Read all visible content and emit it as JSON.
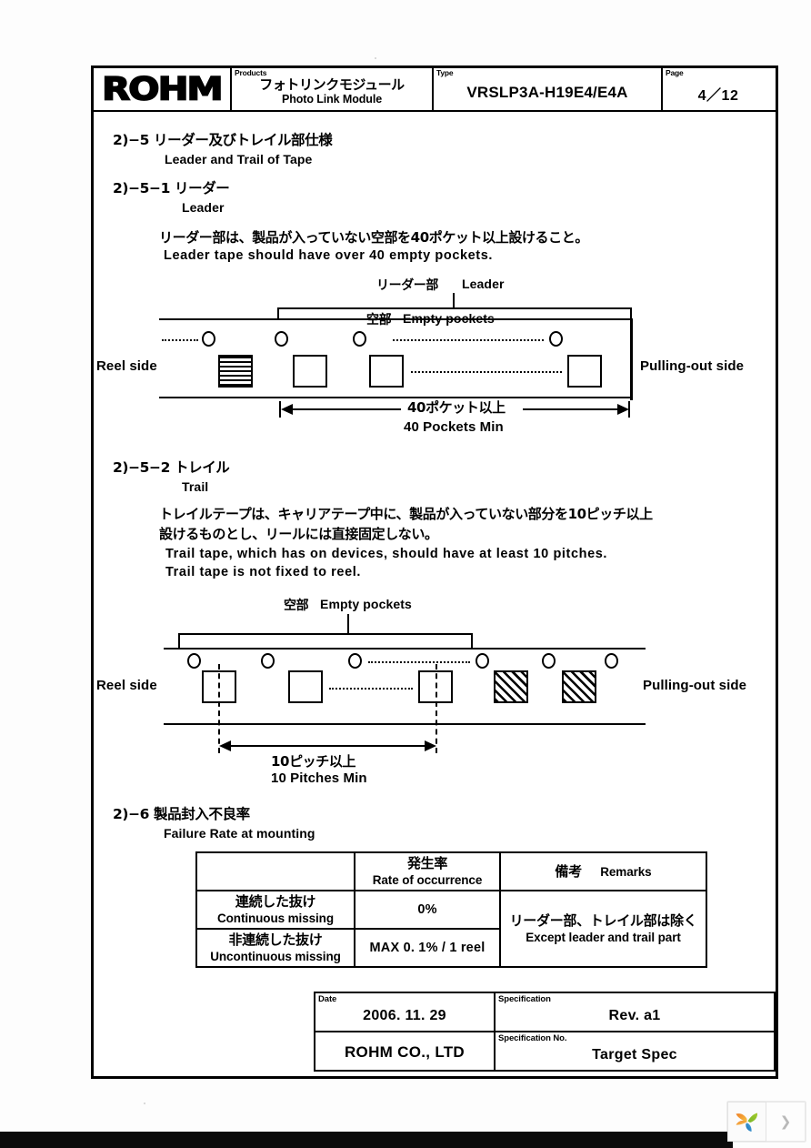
{
  "header": {
    "logo_text": "ROHM",
    "products_label": "Products",
    "products_jp": "フォトリンクモジュール",
    "products_en": "Photo Link Module",
    "type_label": "Type",
    "type_value": "VRSLP3A-H19E4/E4A",
    "page_label": "Page",
    "page_value": "4／12"
  },
  "sections": {
    "s25": {
      "number_jp": "2)−5  リーダー及びトレイル部仕様",
      "title_en": "Leader  and  Trail  of  Tape"
    },
    "s251": {
      "number_jp": "2)−5−1  リーダー",
      "title_en": "Leader",
      "body_jp": "リーダー部は、製品が入っていない空部を40ポケット以上設けること。",
      "body_en": "Leader  tape  should  have  over 40  empty  pockets."
    },
    "s252": {
      "number_jp": "2)−5−2  トレイル",
      "title_en": "Trail",
      "body_jp_line1": "トレイルテープは、キャリアテープ中に、製品が入っていない部分を10ピッチ以上",
      "body_jp_line2": "設けるものとし、リールには直接固定しない。",
      "body_en_line1": "Trail  tape,  which  has  on  devices,   should  have  at  least  10  pitches.",
      "body_en_line2": "Trail  tape  is  not  fixed  to  reel."
    },
    "s26": {
      "number_jp": "2)−6  製品封入不良率",
      "title_en": "Failure  Rate  at  mounting"
    }
  },
  "leader_diagram": {
    "caption_jp": "リーダー部",
    "caption_en": "Leader",
    "bracket_jp": "空部",
    "bracket_en": "Empty  pockets",
    "left_side_label": "Reel side",
    "right_side_label": "Pulling-out  side",
    "dimension_jp": "40ポケット以上",
    "dimension_en": "40  Pockets  Min",
    "holes": 4,
    "pockets": 4,
    "filled_pocket_index": 0,
    "fill_style": "horizontal-hatch"
  },
  "trail_diagram": {
    "bracket_jp": "空部",
    "bracket_en": "Empty  pockets",
    "left_side_label": "Reel side",
    "right_side_label": "Pulling-out  side",
    "dimension_jp": "10ピッチ以上",
    "dimension_en": "10  Pitches  Min",
    "holes": 6,
    "pockets": 5,
    "filled_pocket_indices": [
      3,
      4
    ],
    "fill_style": "diagonal-hatch"
  },
  "failure_table": {
    "columns": [
      {
        "jp": "",
        "en": ""
      },
      {
        "jp": "発生率",
        "en": "Rate of occurrence"
      },
      {
        "jp": "備考",
        "en": "Remarks"
      }
    ],
    "rows": [
      {
        "label_jp": "連続した抜け",
        "label_en": "Continuous missing",
        "rate": "0%"
      },
      {
        "label_jp": "非連続した抜け",
        "label_en": "Uncontinuous missing",
        "rate": "MAX  0. 1% / 1 reel"
      }
    ],
    "remarks_jp": "リーダー部、トレイル部は除く",
    "remarks_en": "Except leader and trail part"
  },
  "footer": {
    "date_label": "Date",
    "date_value": "2006. 11. 29",
    "spec_label": "Specification",
    "spec_value": "Rev. a1",
    "company": "ROHM CO., LTD",
    "spec_no_label": "Specification No.",
    "spec_no_value": "Target Spec"
  },
  "watermark": {
    "logo_name": "leaf-pinwheel-logo",
    "next_glyph": "❯",
    "colors": {
      "orange": "#e8822a",
      "yellow": "#f0b135",
      "green": "#8fbf2b",
      "blue": "#2b85c8"
    }
  }
}
